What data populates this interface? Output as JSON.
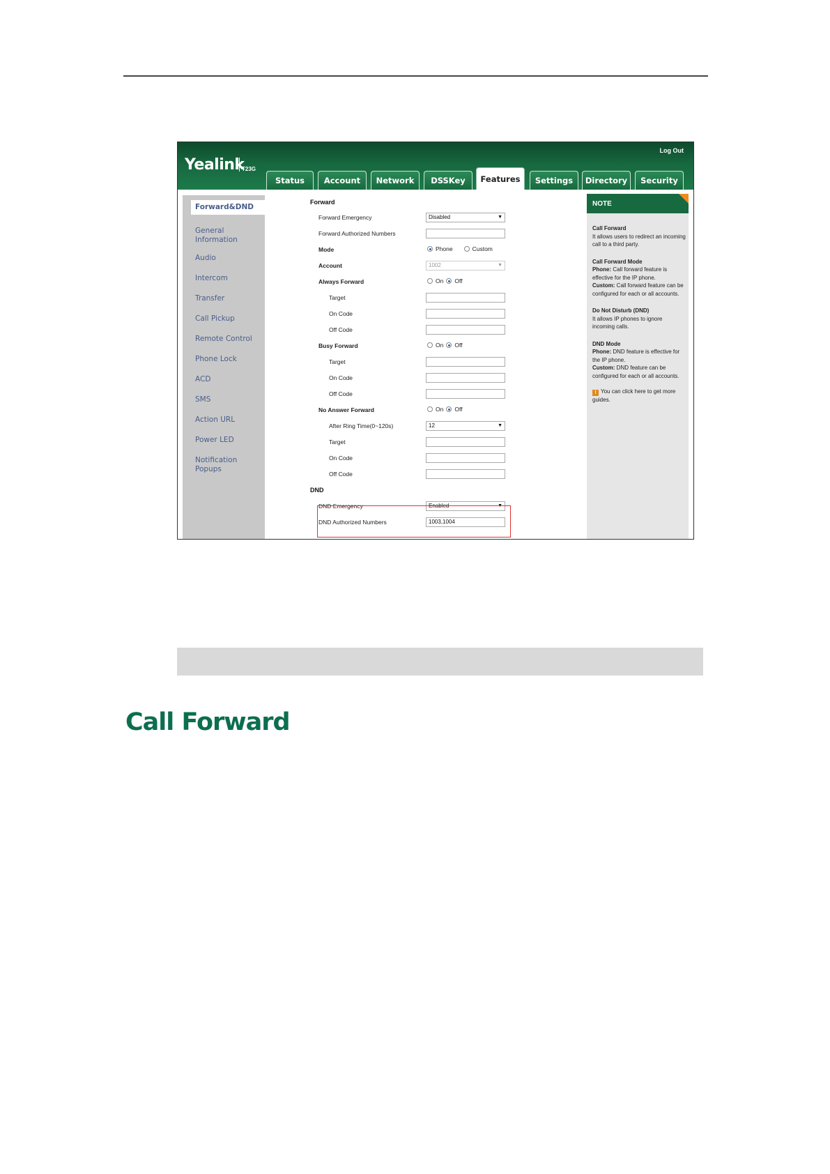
{
  "header": {
    "logo": "Yealink",
    "model": "T23G",
    "logout": "Log Out"
  },
  "tabs": [
    "Status",
    "Account",
    "Network",
    "DSSKey",
    "Features",
    "Settings",
    "Directory",
    "Security"
  ],
  "active_tab": "Features",
  "leftnav": {
    "active": "Forward&DND",
    "items": [
      "General\nInformation",
      "Audio",
      "Intercom",
      "Transfer",
      "Call Pickup",
      "Remote Control",
      "Phone Lock",
      "ACD",
      "SMS",
      "Action URL",
      "Power LED",
      "Notification Popups"
    ]
  },
  "form": {
    "forward_title": "Forward",
    "forward_emergency_label": "Forward Emergency",
    "forward_emergency_value": "Disabled",
    "forward_auth_label": "Forward Authorized Numbers",
    "mode_label": "Mode",
    "mode_phone": "Phone",
    "mode_custom": "Custom",
    "account_label": "Account",
    "account_value": "1002",
    "always_label": "Always Forward",
    "on": "On",
    "off": "Off",
    "target": "Target",
    "on_code": "On Code",
    "off_code": "Off Code",
    "busy_label": "Busy Forward",
    "noanswer_label": "No Answer Forward",
    "after_ring_label": "After Ring Time(0~120s)",
    "after_ring_value": "12",
    "dnd_title": "DND",
    "dnd_emergency_label": "DND Emergency",
    "dnd_emergency_value": "Enabled",
    "dnd_auth_label": "DND Authorized Numbers",
    "dnd_auth_value": "1003,1004"
  },
  "note": {
    "title": "NOTE",
    "cf_title": "Call Forward",
    "cf_text": "It allows users to redirect an incoming call to a third party.",
    "cfm_title": "Call Forward Mode",
    "cfm_phone_label": "Phone:",
    "cfm_phone_text": " Call forward feature is effective for the IP phone.",
    "cfm_custom_label": "Custom:",
    "cfm_custom_text": " Call forward feature can be configured for each or all accounts.",
    "dnd_title": "Do Not Disturb (DND)",
    "dnd_text": "It allows IP phones to ignore incoming calls.",
    "dndm_title": "DND Mode",
    "dndm_phone_label": "Phone:",
    "dndm_phone_text": " DND feature is effective for the IP phone.",
    "dndm_custom_label": "Custom:",
    "dndm_custom_text": " DND feature can be configured for each or all accounts.",
    "guide_text": "You can click here to get more guides."
  },
  "section_title": "Call Forward"
}
